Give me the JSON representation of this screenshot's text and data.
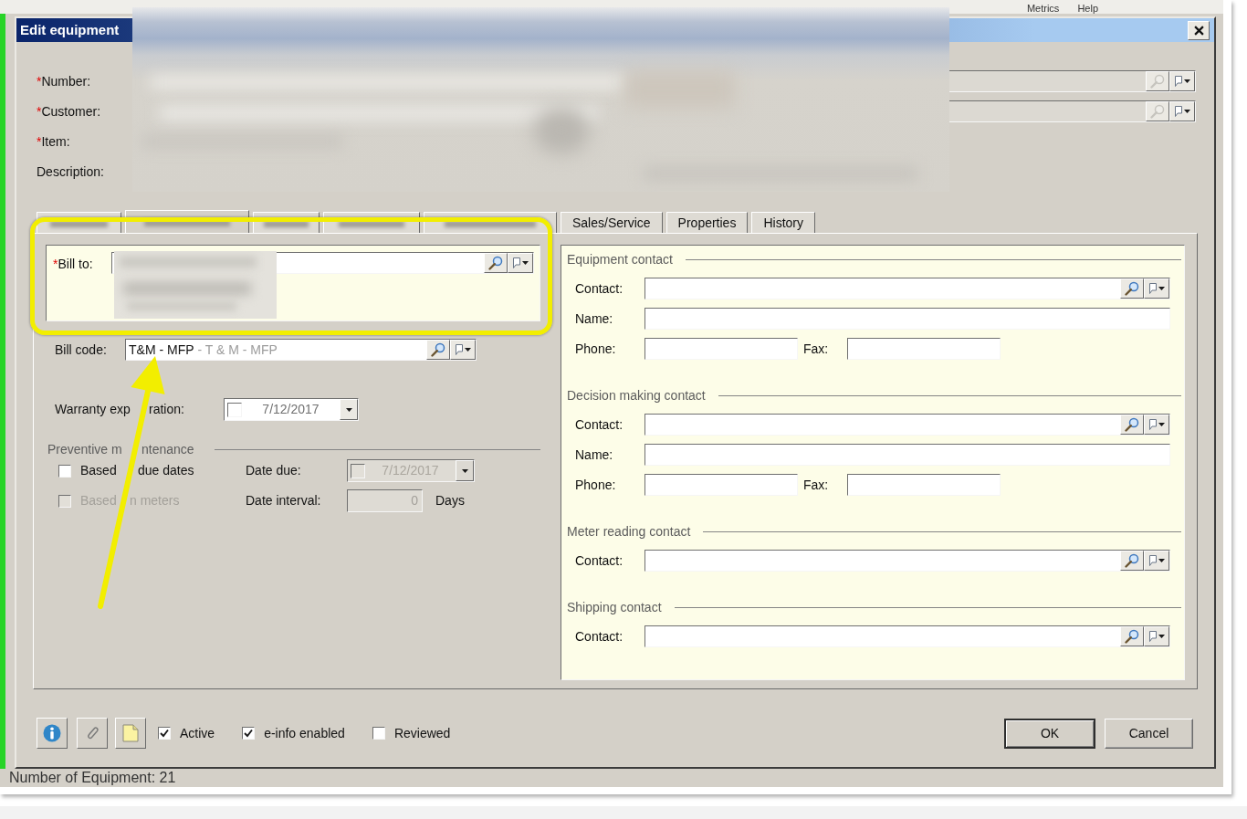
{
  "app_window": {
    "menu": [
      "Metrics",
      "Help"
    ],
    "status_bar": "Number of Equipment: 21"
  },
  "dialog": {
    "title": "Edit equipment",
    "header_fields": [
      {
        "kind": "lookup",
        "required_mark": "*",
        "label": "Number:"
      },
      {
        "kind": "lookup",
        "required_mark": "*",
        "label": "Customer:"
      },
      {
        "kind": "label_only",
        "required_mark": "*",
        "label": "Item:"
      },
      {
        "kind": "label_only",
        "label": "Description:"
      }
    ],
    "tabs": [
      {
        "kind": "obscured",
        "selected": false
      },
      {
        "kind": "obscured",
        "selected": true
      },
      {
        "kind": "obscured",
        "selected": false
      },
      {
        "kind": "obscured",
        "selected": false
      },
      {
        "kind": "obscured",
        "selected": false
      },
      {
        "kind": "labeled",
        "label": "Sales/Service",
        "selected": false
      },
      {
        "kind": "labeled",
        "label": "Properties",
        "selected": false
      },
      {
        "kind": "labeled",
        "label": "History",
        "selected": false
      }
    ],
    "billing": {
      "bill_to": {
        "required_mark": "*",
        "label": "Bill to:"
      },
      "bill_code": {
        "label": "Bill code:",
        "code": "T&M - MFP",
        "description": "- T & M - MFP"
      },
      "warranty_expiration": {
        "label_parts": [
          "Warranty exp",
          "ration:"
        ],
        "checked": false,
        "value": "7/12/2017"
      },
      "preventive_maintenance": {
        "title_parts": [
          "Preventive m",
          "ntenance"
        ],
        "options": [
          {
            "label_parts": [
              "Based",
              "due dates"
            ],
            "checked": false,
            "disabled": false
          },
          {
            "label_parts": [
              "Based",
              "n meters"
            ],
            "checked": false,
            "disabled": true
          }
        ],
        "date_due": {
          "label": "Date due:",
          "value": "7/12/2017",
          "checked": false,
          "disabled": true
        },
        "date_interval": {
          "label": "Date interval:",
          "value": "0",
          "unit": "Days",
          "disabled": true
        }
      }
    },
    "contact_groups": [
      {
        "title": "Equipment contact",
        "rows": [
          {
            "kind": "lookup",
            "label": "Contact:"
          },
          {
            "kind": "text",
            "label": "Name:"
          },
          {
            "kind": "phone_fax",
            "label": "Phone:",
            "fax_label": "Fax:"
          }
        ]
      },
      {
        "title": "Decision making contact",
        "rows": [
          {
            "kind": "lookup",
            "label": "Contact:"
          },
          {
            "kind": "text",
            "label": "Name:"
          },
          {
            "kind": "phone_fax",
            "label": "Phone:",
            "fax_label": "Fax:"
          }
        ]
      },
      {
        "title": "Meter reading contact",
        "rows": [
          {
            "kind": "lookup",
            "label": "Contact:"
          }
        ]
      },
      {
        "title": "Shipping contact",
        "rows": [
          {
            "kind": "lookup",
            "label": "Contact:"
          }
        ]
      }
    ],
    "footer": {
      "checkboxes": [
        {
          "label": "Active",
          "checked": true
        },
        {
          "label": "e-info enabled",
          "checked": true
        },
        {
          "label": "Reviewed",
          "checked": false
        }
      ],
      "buttons": [
        {
          "label": "OK",
          "default": true
        },
        {
          "label": "Cancel",
          "default": false
        }
      ]
    }
  }
}
